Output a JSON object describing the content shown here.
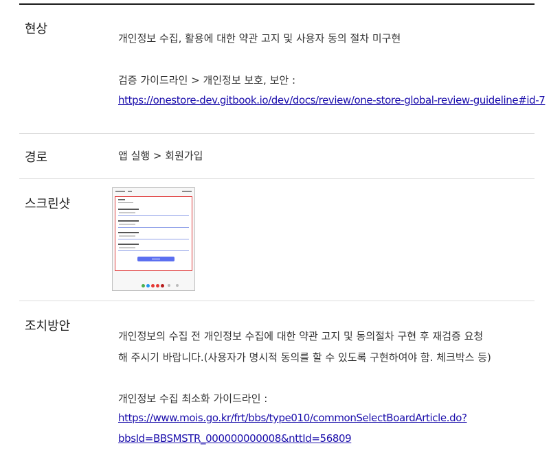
{
  "rows": {
    "phenomenon": {
      "label": "현상",
      "description": "개인정보 수집, 활용에 대한 약관 고지 및 사용자 동의 절차 미구현",
      "guide_label": "검증 가이드라인 > 개인정보 보호, 보안 :",
      "guide_link": "https://onestore-dev.gitbook.io/dev/docs/review/one-store-global-review-guideline#id-7"
    },
    "path": {
      "label": "경로",
      "value": "앱 실행 > 회원가입"
    },
    "screenshot": {
      "label": "스크린샷"
    },
    "action": {
      "label": "조치방안",
      "text_line1": "개인정보의 수집 전 개인정보 수집에 대한 약관 고지 및 동의절차 구현 후 재검증 요청",
      "text_line2": "해 주시기 바랍니다.(사용자가 명시적 동의를 할 수 있도록 구현하여야 함. 체크박스 등)",
      "guide_label": "개인정보 수집 최소화 가이드라인 :",
      "guide_link_line1": "https://www.mois.go.kr/frt/bbs/type010/commonSelectBoardArticle.do?",
      "guide_link_line2": "bbsId=BBSMSTR_000000000008&nttId=56809"
    }
  },
  "colors": {
    "link": "#1a0dab",
    "highlight_border": "#e04040",
    "phone_button": "#5b6ff0"
  }
}
